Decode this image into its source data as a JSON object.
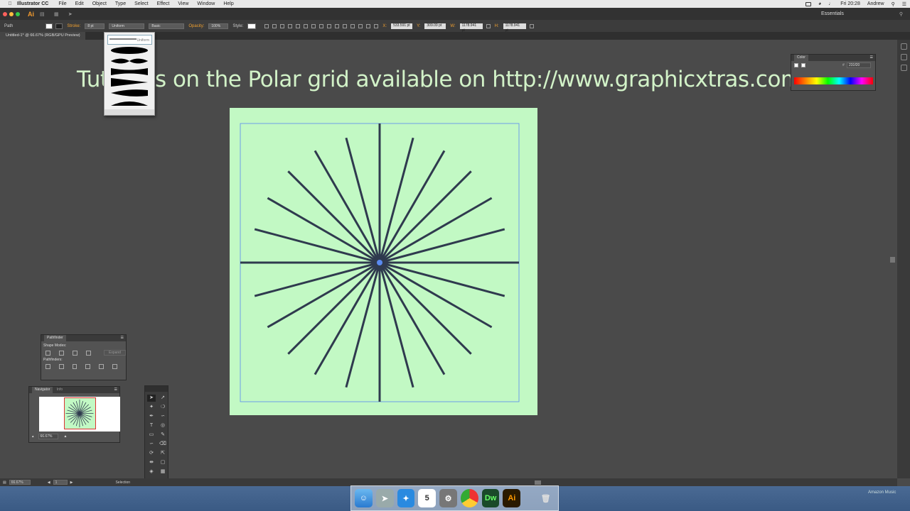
{
  "menubar": {
    "app_name": "Illustrator CC",
    "items": [
      "File",
      "Edit",
      "Object",
      "Type",
      "Select",
      "Effect",
      "View",
      "Window",
      "Help"
    ],
    "time": "Fri 20:28",
    "user": "Andrew"
  },
  "appbar": {
    "logo": "Ai",
    "workspace": "Essentials"
  },
  "controlbar": {
    "selection_label": "Path",
    "stroke_label": "Stroke:",
    "stroke_value": "8 pt",
    "profile_value": "Uniform",
    "brush_value": "Basic",
    "opacity_label": "Opacity:",
    "opacity_value": "100%",
    "style_label": "Style:",
    "x_label": "X:",
    "x_value": "533.591 pt",
    "y_label": "Y:",
    "y_value": "309.09 pt",
    "w_label": "W:",
    "w_value": "1178.941 pt",
    "h_label": "H:",
    "h_value": "1178.941 pt"
  },
  "document": {
    "tab_title": "Untitled-1* @ 66.67% (RGB/GPU Preview)"
  },
  "canvas": {
    "heading": "Tutorials on the Polar grid available on http://www.graphicxtras.com"
  },
  "profile_dropdown": {
    "selected": "Uniform",
    "options": [
      "Uniform",
      "Width Profile 1",
      "Width Profile 2",
      "Width Profile 3",
      "Width Profile 4",
      "Width Profile 5",
      "Width Profile 6",
      "Width Profile 7"
    ]
  },
  "color_panel": {
    "title": "Color",
    "hex_label": "#",
    "hex_value": "231f20"
  },
  "pathfinder": {
    "title": "Pathfinder",
    "shape_modes_label": "Shape Modes:",
    "expand_label": "Expand",
    "pathfinders_label": "Pathfinders:"
  },
  "navigator": {
    "tab_navigator": "Navigator",
    "tab_info": "Info",
    "zoom": "66.67%"
  },
  "statusbar": {
    "zoom": "66.67%",
    "artboard": "1",
    "tool": "Selection"
  },
  "dock": {
    "calendar_day": "5",
    "dw_label": "Dw",
    "ai_label": "Ai",
    "now_playing": "Amazon Music"
  },
  "colors": {
    "artboard": "#c2f9c4",
    "heading": "#d2f2c8",
    "stroke": "#2f3a4e",
    "selection": "#5a8af0",
    "accent": "#f29a2e"
  }
}
